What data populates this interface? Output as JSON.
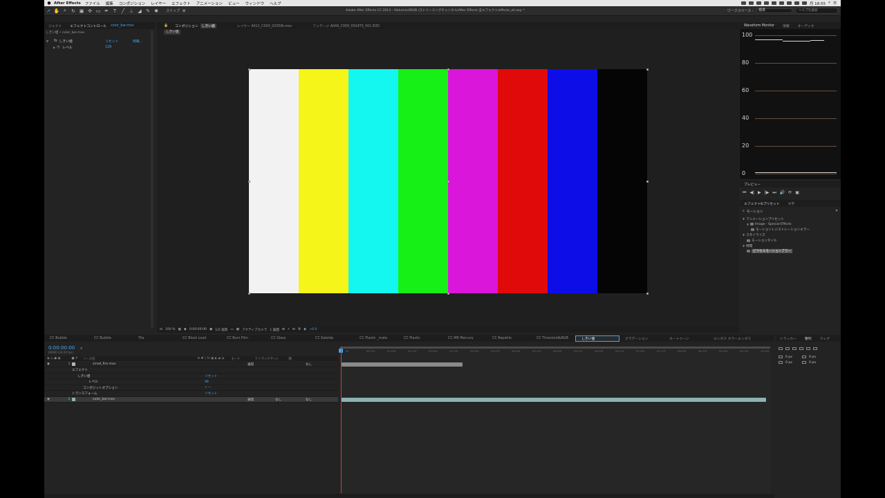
{
  "menubar": {
    "app_name": "After Effects",
    "items": [
      "ファイル",
      "編集",
      "コンポジション",
      "レイヤー",
      "エフェクト",
      "アニメーション",
      "ビュー",
      "ウィンドウ",
      "ヘルプ"
    ],
    "clock": "月 18:55"
  },
  "toolbar": {
    "snap_label": "スナップ",
    "document_title": "Adobe After Effects CC 2014 - /Volumes/RAID /ストリーミングチャンネル/After Effects 全エフェクト/effects_all.aep *",
    "workspace_label": "ワークスペース :",
    "workspace_value": "標準",
    "help_placeholder": "ヘルプを検索"
  },
  "effects_panel": {
    "tabs": [
      "ジェクト",
      "エフェクトコントロール",
      "color_bar.mov"
    ],
    "subtitle": "しきい値 • color_bar.mov",
    "effect_name": "しきい値",
    "reset_label": "リセット",
    "about_label": "情報...",
    "param_label": "レベル",
    "param_value": "128"
  },
  "comp_panel": {
    "tabs": [
      "コンポジション",
      "しきい値",
      "レイヤー A011_C003_0205IN.mov",
      "フッテージ A049_C009_0504T0_001.R3D"
    ],
    "comp_chip": "しきい値",
    "footer": {
      "zoom": "100 %",
      "timecode": "0:00:00:00",
      "resolution": "1/2 画質",
      "camera": "アクティブカメラ",
      "views": "1 画面",
      "exposure": "+0.0"
    }
  },
  "color_bars": [
    "#f2f2f2",
    "#f5f51a",
    "#14f7f0",
    "#16f016",
    "#d916d9",
    "#e10a0a",
    "#0d0de8",
    "#050505"
  ],
  "waveform": {
    "tabs": [
      "Waveform Monitor",
      "情報",
      "オーディオ"
    ],
    "labels": [
      "100",
      "80",
      "60",
      "40",
      "20",
      "0"
    ]
  },
  "preview": {
    "tab": "プレビュー",
    "controls": [
      "⏮",
      "◀|",
      "▶",
      "|▶",
      "⏭",
      "🔊",
      "⟳",
      "▣"
    ]
  },
  "presets": {
    "tabs": [
      "エフェクト&プリセット",
      "文字"
    ],
    "search_value": "モーション",
    "tree": [
      {
        "label": "アニメーションプリセット",
        "level": 0,
        "folder": true
      },
      {
        "label": "Image - Special Effects",
        "level": 1,
        "folder": true
      },
      {
        "label": "モーションレジストレーションエラー",
        "level": 2,
        "folder": false
      },
      {
        "label": "スタイライズ",
        "level": 0,
        "folder": true
      },
      {
        "label": "モーションタイル",
        "level": 1,
        "folder": false
      },
      {
        "label": "時間",
        "level": 0,
        "folder": true
      },
      {
        "label": "ピクセルモーションブラー",
        "level": 1,
        "folder": false,
        "highlight": true
      }
    ]
  },
  "timeline": {
    "tabs": [
      "CC Bubble",
      "CC Bubble",
      "Tile",
      "CC Block Load",
      "CC Burn Film",
      "CC Glass",
      "CC Kaleida",
      "CC Plastic _mate",
      "CC Plastic",
      "CC MR Mercury",
      "CC Repetile",
      "CC Threshold&RGB",
      "しきい値",
      "グラデーション",
      "カートゥーン",
      "エンボス カラーエンボス"
    ],
    "active_tab": "しきい値",
    "timecode": "0:00:00:00",
    "timecode_sub": "00000 (24.00 fps)",
    "header": {
      "source_name": "ソース名",
      "mode": "モード",
      "trkmat": "T トラックマット",
      "parent": "親"
    },
    "rows": [
      {
        "num": "1",
        "name": "small_fire.mov",
        "mode": "通常",
        "parent": "なし",
        "swatch": "#b5b5b5"
      },
      {
        "name": "エフェクト"
      },
      {
        "name": "しきい値",
        "value": "リセット"
      },
      {
        "name": "レベル",
        "value": "98"
      },
      {
        "name": "コンポジットオプション",
        "value": "+ −"
      },
      {
        "name": "トランスフォーム",
        "value": "リセット"
      },
      {
        "num": "2",
        "name": "color_bar.mov",
        "mode": "通常",
        "trk": "なし",
        "parent": "なし",
        "swatch": "#8bb3b3"
      }
    ],
    "ruler_ticks": [
      "0s",
      "00:12f",
      "01:00f",
      "01:12f",
      "02:00f",
      "02:12f",
      "03:00f",
      "03:12f",
      "04:00f",
      "04:12f",
      "05:00f",
      "05:12f",
      "06:00f",
      "06:12f",
      "07:00f",
      "07:12f",
      "08:00f",
      "08:12f",
      "09:00f",
      "09:12f",
      "10:00f"
    ]
  },
  "tracker": {
    "tabs": [
      "トラッカー",
      "整列",
      "ウィグ"
    ],
    "distances": [
      "0 px",
      "0 px",
      "0 px",
      "0 px"
    ]
  }
}
